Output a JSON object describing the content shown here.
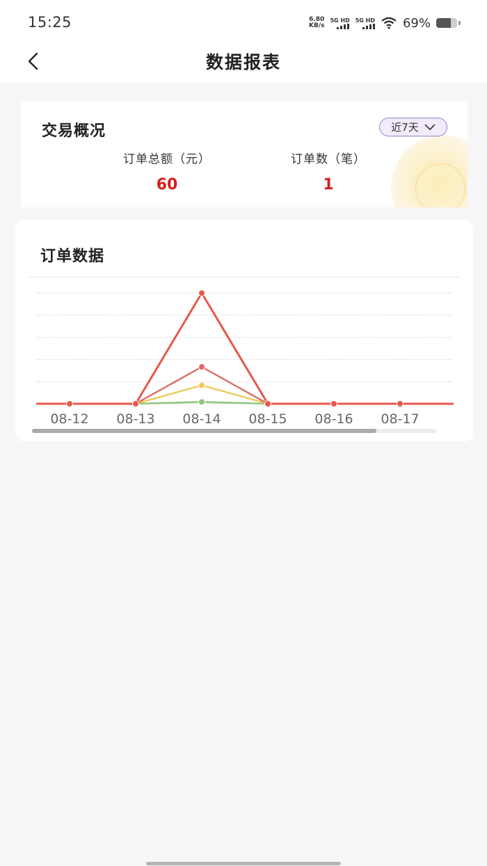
{
  "status_bar": {
    "time": "15:25",
    "net_speed_value": "6.80",
    "net_speed_unit": "KB/s",
    "sim1_label": "5G HD",
    "sim2_label": "5G HD",
    "battery_percent": "69%",
    "battery_level": 0.69,
    "icons": [
      "wifi-icon",
      "signal-icon",
      "battery-icon"
    ]
  },
  "nav": {
    "back_icon": "chevron-left-icon",
    "title": "数据报表"
  },
  "overview": {
    "title": "交易概况",
    "period_label": "近7天",
    "period_icon": "chevron-down-icon",
    "stats": [
      {
        "label": "订单总额（元）",
        "value": "60"
      },
      {
        "label": "订单数（笔）",
        "value": "1"
      }
    ]
  },
  "order_chart": {
    "title": "订单数据",
    "scroll_fraction": 0.85
  },
  "colors": {
    "accent_red": "#d81e1e",
    "period_border": "#9b7ed0",
    "series": [
      "#e8574a",
      "#dd6a6a",
      "#efc85a",
      "#8cc67a"
    ]
  },
  "chart_data": {
    "type": "line",
    "categories": [
      "08-12",
      "08-13",
      "08-14",
      "08-15",
      "08-16",
      "08-17"
    ],
    "series": [
      {
        "values": [
          0,
          0,
          60,
          0,
          0,
          0
        ],
        "color": "#e8574a"
      },
      {
        "values": [
          0,
          0,
          20,
          0,
          0,
          0
        ],
        "color": "#dd6a6a"
      },
      {
        "values": [
          0,
          0,
          10,
          0,
          0,
          0
        ],
        "color": "#efc85a"
      },
      {
        "values": [
          0,
          0,
          1,
          0,
          0,
          0
        ],
        "color": "#8cc67a"
      }
    ],
    "ylim": [
      0,
      60
    ],
    "grid": true,
    "legend": "none",
    "xlabel": "",
    "ylabel": ""
  }
}
